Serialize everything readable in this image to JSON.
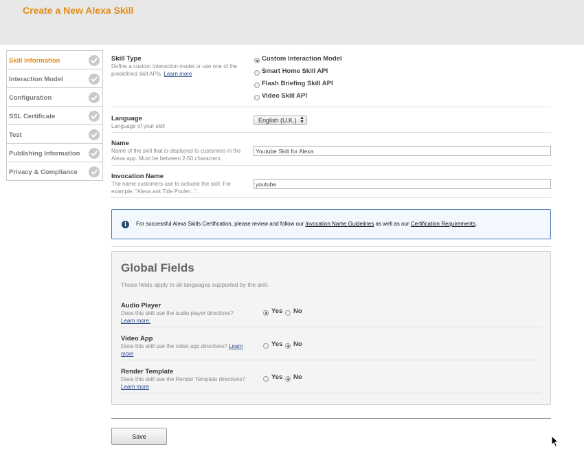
{
  "header": {
    "title": "Create a New Alexa Skill"
  },
  "sidebar": {
    "items": [
      {
        "label": "Skill Information",
        "active": true
      },
      {
        "label": "Interaction Model"
      },
      {
        "label": "Configuration"
      },
      {
        "label": "SSL Certificate"
      },
      {
        "label": "Test"
      },
      {
        "label": "Publishing Information"
      },
      {
        "label": "Privacy & Compliance"
      }
    ]
  },
  "skill_type": {
    "label": "Skill Type",
    "desc": "Define a custom interaction model or use one of the predefined skill APIs.",
    "learn_more": "Learn more",
    "options": [
      {
        "label": "Custom Interaction Model",
        "checked": true
      },
      {
        "label": "Smart Home Skill API"
      },
      {
        "label": "Flash Briefing Skill API"
      },
      {
        "label": "Video Skill API"
      }
    ]
  },
  "language": {
    "label": "Language",
    "desc": "Language of your skill",
    "selected": "English (U.K.)"
  },
  "name": {
    "label": "Name",
    "desc": "Name of the skill that is displayed to customers in the Alexa app. Must be between 2-50 characters.",
    "value": "Youtube Skill for Alexa"
  },
  "invocation": {
    "label": "Invocation Name",
    "desc": "The name customers use to activate the skill. For example, \"Alexa ask Tide Pooler...\".",
    "value": "youtube"
  },
  "info": {
    "text_before": "For successful Alexa Skills Certification, please review and follow our ",
    "link1": "Invocation Name Guidelines",
    "text_middle": " as well as our ",
    "link2": "Certification Requirements",
    "text_after": "."
  },
  "global_fields": {
    "title": "Global Fields",
    "desc": "These fields apply to all languages supported by the skill.",
    "yes_label": "Yes",
    "no_label": "No",
    "audio_player": {
      "label": "Audio Player",
      "desc": "Does this skill use the audio player directives?",
      "learn_more": "Learn more.",
      "value": "Yes"
    },
    "video_app": {
      "label": "Video App",
      "desc": "Does this skill use the video app directives?",
      "learn_more_a": "Learn",
      "learn_more_b": "more",
      "value": "No"
    },
    "render_template": {
      "label": "Render Template",
      "desc": "Does this skill use the Render Template directives?",
      "learn_more": "Learn more",
      "value": "No"
    }
  },
  "save_label": "Save",
  "colors": {
    "accent": "#e48b17",
    "info_border": "#3f78b5",
    "info_bg": "#f2f8fd"
  }
}
